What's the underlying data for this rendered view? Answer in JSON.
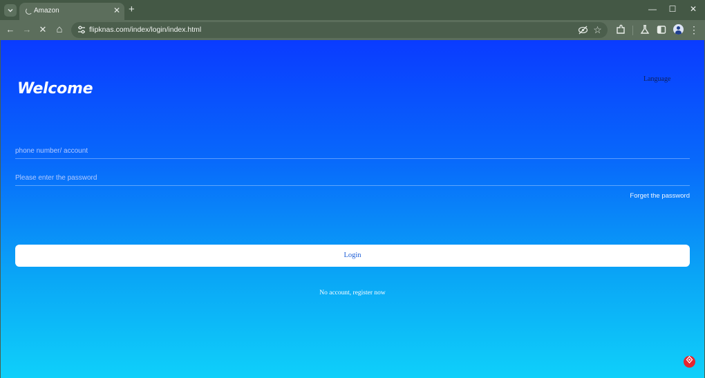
{
  "browser": {
    "tab": {
      "title": "Amazon",
      "close_glyph": "✕"
    },
    "new_tab_glyph": "+",
    "window_controls": {
      "minimize": "—",
      "maximize": "☐",
      "close": "✕"
    },
    "toolbar": {
      "back_glyph": "←",
      "forward_glyph": "→",
      "stop_glyph": "✕",
      "home_glyph": "⌂",
      "url": "flipknas.com/index/login/index.html",
      "star_glyph": "☆",
      "menu_glyph": "⋮"
    },
    "icons": [
      "tab-search-icon",
      "loading-spinner-icon",
      "back-icon",
      "forward-icon",
      "stop-icon",
      "home-icon",
      "site-info-icon",
      "eye-off-icon",
      "star-icon",
      "extensions-icon",
      "labs-icon",
      "side-panel-icon",
      "profile-icon",
      "menu-icon"
    ]
  },
  "page": {
    "welcome": "Welcome",
    "language": "Language",
    "account_placeholder": "phone number/ account",
    "password_placeholder": "Please enter the password",
    "forget_password": "Forget the password",
    "login_button": "Login",
    "register_link": "No account, register now",
    "colors": {
      "gradient_top": "#0a3bff",
      "gradient_bottom": "#0fd0fa",
      "button_bg": "#ffffff",
      "button_text": "#1b5cd6"
    }
  }
}
